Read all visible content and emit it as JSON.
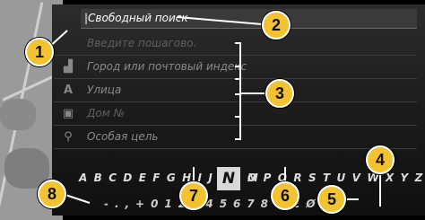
{
  "search": {
    "label": "Свободный поиск"
  },
  "menu": [
    {
      "label": "Введите пошагово.",
      "icon": "none"
    },
    {
      "label": "Город или почтовый индекс",
      "icon": "city-icon"
    },
    {
      "label": "Улица",
      "icon": "street-icon"
    },
    {
      "label": "Дом №",
      "icon": "house-number-icon"
    },
    {
      "label": "Особая цель",
      "icon": "poi-icon"
    }
  ],
  "keyboard": {
    "letters_left": "A B C D E F G H I J K L M",
    "selected_key": "N",
    "letters_right": "O P Q R S T U V W X Y Z",
    "row2": "- . , + 0 1 2 3 4 5 6 7 8 9 Æ Ø"
  },
  "callouts": [
    "1",
    "2",
    "3",
    "4",
    "5",
    "6",
    "7",
    "8"
  ],
  "colors": {
    "callout": "#f2c230",
    "background": "#1a1a1a"
  }
}
